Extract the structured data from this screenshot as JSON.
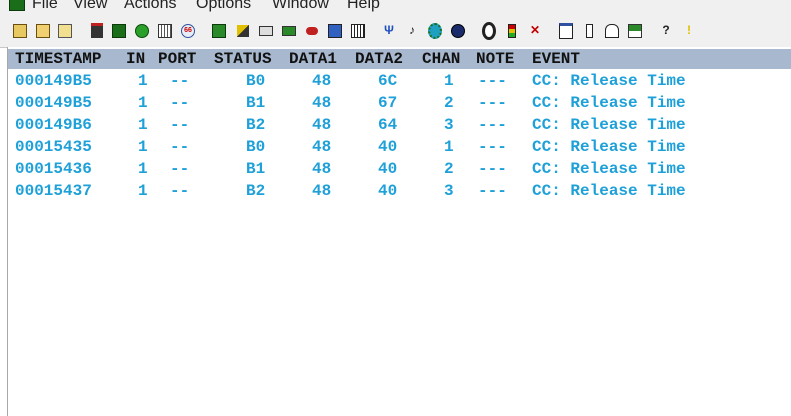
{
  "menu": [
    "File",
    "View",
    "Actions",
    "Options",
    "Window",
    "Help"
  ],
  "toolbar": {
    "icons": [
      "open-icon",
      "open-folder-icon",
      "save-icon",
      "film-icon",
      "film-clip-icon",
      "record-icon",
      "grid-icon",
      "tempo-66-icon",
      "keyboard-icon",
      "brush-icon",
      "midi-port-icon",
      "device-icon",
      "cable-icon",
      "monitor-icon",
      "piano-icon",
      "filter-icon",
      "note-icon",
      "gear-icon",
      "globe-icon",
      "disc-icon",
      "traffic-light-icon",
      "close-x-icon",
      "window-icon",
      "split-icon",
      "building-icon",
      "flag-icon",
      "help-icon",
      "exclamation-icon"
    ],
    "labels": {
      "help": "?",
      "exclamation": "!",
      "close": "✕",
      "tempo": "66"
    }
  },
  "table": {
    "headers": {
      "timestamp": "TIMESTAMP",
      "in": "IN",
      "port": "PORT",
      "status": "STATUS",
      "data1": "DATA1",
      "data2": "DATA2",
      "chan": "CHAN",
      "note": "NOTE",
      "event": "EVENT"
    },
    "rows": [
      {
        "timestamp": "000149B5",
        "in": "1",
        "port": "--",
        "status": "B0",
        "data1": "48",
        "data2": "6C",
        "chan": "1",
        "note": "---",
        "event": "CC: Release Time"
      },
      {
        "timestamp": "000149B5",
        "in": "1",
        "port": "--",
        "status": "B1",
        "data1": "48",
        "data2": "67",
        "chan": "2",
        "note": "---",
        "event": "CC: Release Time"
      },
      {
        "timestamp": "000149B6",
        "in": "1",
        "port": "--",
        "status": "B2",
        "data1": "48",
        "data2": "64",
        "chan": "3",
        "note": "---",
        "event": "CC: Release Time"
      },
      {
        "timestamp": "00015435",
        "in": "1",
        "port": "--",
        "status": "B0",
        "data1": "48",
        "data2": "40",
        "chan": "1",
        "note": "---",
        "event": "CC: Release Time"
      },
      {
        "timestamp": "00015436",
        "in": "1",
        "port": "--",
        "status": "B1",
        "data1": "48",
        "data2": "40",
        "chan": "2",
        "note": "---",
        "event": "CC: Release Time"
      },
      {
        "timestamp": "00015437",
        "in": "1",
        "port": "--",
        "status": "B2",
        "data1": "48",
        "data2": "40",
        "chan": "3",
        "note": "---",
        "event": "CC: Release Time"
      }
    ]
  },
  "colors": {
    "header_bg": "#a8b9cf",
    "row_text": "#1ea0d8",
    "header_text": "#111111"
  }
}
